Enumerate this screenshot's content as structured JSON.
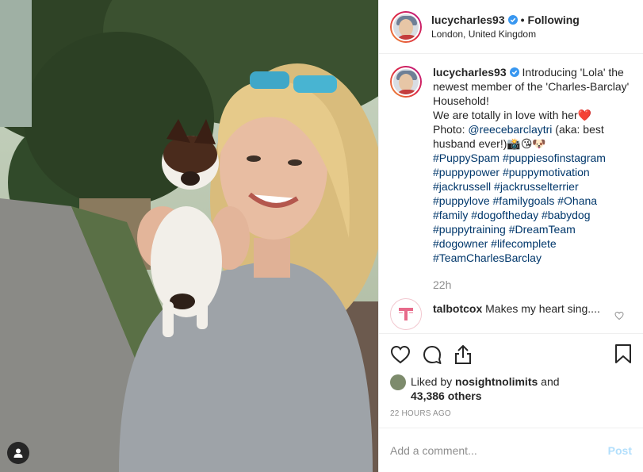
{
  "header": {
    "username": "lucycharles93",
    "separator": "•",
    "follow_status": "Following",
    "location": "London, United Kingdom"
  },
  "caption": {
    "username": "lucycharles93",
    "line1": "Introducing 'Lola' the newest member of the 'Charles-Barclay' Household!",
    "line2": "We are totally in love with her❤️",
    "photo_prefix": "Photo: ",
    "mention": "@reecebarclaytri",
    "line3_rest": " (aka: best husband ever!)📸😘🐶",
    "hashtags": [
      "#PuppySpam",
      "#puppiesofinstagram",
      "#puppypower",
      "#puppymotivation",
      "#jackrussell",
      "#jackrusselterrier",
      "#puppylove",
      "#familygoals",
      "#Ohana",
      "#family",
      "#dogoftheday",
      "#babydog",
      "#puppytraining",
      "#DreamTeam",
      "#dogowner",
      "#lifecomplete",
      "#TeamCharlesBarclay"
    ],
    "time": "22h"
  },
  "comment": {
    "username": "talbotcox",
    "text": "Makes my heart sing...."
  },
  "likes": {
    "prefix": "Liked by ",
    "liker": "nosightnolimits",
    "middle": " and",
    "count": "43,386 others"
  },
  "post_date": "22 HOURS AGO",
  "add_comment": {
    "placeholder": "Add a comment...",
    "post_label": "Post"
  },
  "icons": {
    "like": "heart-outline-icon",
    "comment": "speech-bubble-icon",
    "share": "share-icon",
    "save": "bookmark-icon",
    "verified": "verified-badge-icon",
    "user_tag": "person-tag-icon"
  },
  "colors": {
    "link": "#00376b",
    "verified": "#3897f0",
    "post_disabled": "#b2dffc",
    "muted": "#8e8e8e"
  }
}
